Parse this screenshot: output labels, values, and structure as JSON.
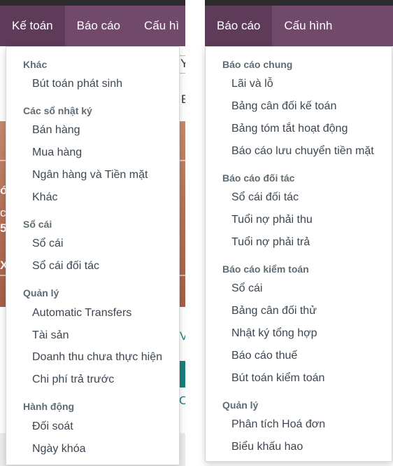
{
  "left_nav": {
    "items": [
      "Kế toán",
      "Báo cáo",
      "Cấu hì"
    ]
  },
  "right_nav": {
    "items": [
      "Báo cáo",
      "Cấu hình"
    ]
  },
  "left_menu": {
    "sections": [
      {
        "title": "Khác",
        "items": [
          "Bút toán phát sinh"
        ]
      },
      {
        "title": "Các sổ nhật ký",
        "items": [
          "Bán hàng",
          "Mua hàng",
          "Ngân hàng và Tiền mặt",
          "Khác"
        ]
      },
      {
        "title": "Sổ cái",
        "items": [
          "Sổ cái",
          "Sổ cái đối tác"
        ]
      },
      {
        "title": "Quản lý",
        "items": [
          "Automatic Transfers",
          "Tài sản",
          "Doanh thu chưa thực hiện",
          "Chi phí trả trước"
        ]
      },
      {
        "title": "Hành động",
        "items": [
          "Đối soát",
          "Ngày khóa"
        ]
      }
    ]
  },
  "right_menu": {
    "sections": [
      {
        "title": "Báo cáo chung",
        "items": [
          "Lãi và lỗ",
          "Bảng cân đối kế toán",
          "Bảng tóm tắt hoạt động",
          "Báo cáo lưu chuyển tiền mặt"
        ]
      },
      {
        "title": "Báo cáo đối tác",
        "items": [
          "Sổ cái đối tác",
          "Tuổi nợ phải thu",
          "Tuổi nợ phải trả"
        ]
      },
      {
        "title": "Báo cáo kiểm toán",
        "items": [
          "Sổ cái",
          "Bảng cân đối thử",
          "Nhật ký tổng hợp",
          "Báo cáo thuế",
          "Bút toán kiểm toán"
        ]
      },
      {
        "title": "Quản lý",
        "items": [
          "Phân tích Hoá đơn",
          "Biểu khấu hao"
        ]
      }
    ]
  },
  "background_fragments": {
    "f1": "Y",
    "f2": "E",
    "f3": "ó",
    "f4": "ch",
    "f5": "5",
    "f6": "X",
    "f7": "V",
    "f8": "C"
  },
  "colors": {
    "navbar": "#71496a",
    "navbar_active": "#5e3b58",
    "section_title": "#5f6b73",
    "menu_text": "#3c4650"
  }
}
